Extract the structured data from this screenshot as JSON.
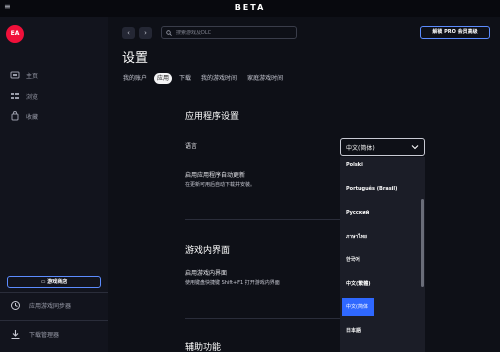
{
  "titlebar": {
    "menu_icon": "hamburger-icon",
    "title": "BETA"
  },
  "sidebar": {
    "logo": "EA",
    "items": [
      {
        "label": "主页",
        "icon": "grid-icon"
      },
      {
        "label": "浏览",
        "icon": "list-icon"
      },
      {
        "label": "收藏",
        "icon": "bag-icon"
      }
    ],
    "promo_label": "游戏商店",
    "bottom": [
      {
        "label": "应用游戏同步器",
        "icon": "sync-icon"
      },
      {
        "label": "下载管理器",
        "icon": "download-icon"
      }
    ]
  },
  "header": {
    "back_icon": "chevron-left-icon",
    "forward_icon": "chevron-right-icon",
    "search_placeholder": "搜索游戏及DLC",
    "pro_button": "解锁 PRO 会员高级"
  },
  "page": {
    "title": "设置",
    "tabs": [
      {
        "label": "我的账户",
        "active": false
      },
      {
        "label": "应用",
        "active": true
      },
      {
        "label": "下载",
        "active": false
      },
      {
        "label": "我的游戏时间",
        "active": false
      },
      {
        "label": "家庭游戏时间",
        "active": false
      }
    ]
  },
  "app_settings": {
    "title": "应用程序设置",
    "language_label": "语言",
    "language_value": "中文(简体)",
    "auto_update_title": "启用应用程序自动更新",
    "auto_update_desc": "在更新可用后自动下载并安装。"
  },
  "in_game": {
    "title": "游戏内界面",
    "enable_label": "启用游戏内界面",
    "enable_desc": "使用键盘快捷键 Shift+F1 打开游戏内界面"
  },
  "accessibility": {
    "title": "辅助功能"
  },
  "language_options": [
    {
      "label": "Polski",
      "selected": false
    },
    {
      "label": "Português (Brasil)",
      "selected": false
    },
    {
      "label": "Русский",
      "selected": false
    },
    {
      "label": "ภาษาไทย",
      "selected": false
    },
    {
      "label": "한국어",
      "selected": false
    },
    {
      "label": "中文(繁體)",
      "selected": false
    },
    {
      "label": "中文(简体",
      "selected": true
    },
    {
      "label": "日本語",
      "selected": false
    }
  ],
  "colors": {
    "accent": "#2f68ff",
    "ea_red": "#f0103a",
    "outline_blue": "#5c8cff"
  }
}
